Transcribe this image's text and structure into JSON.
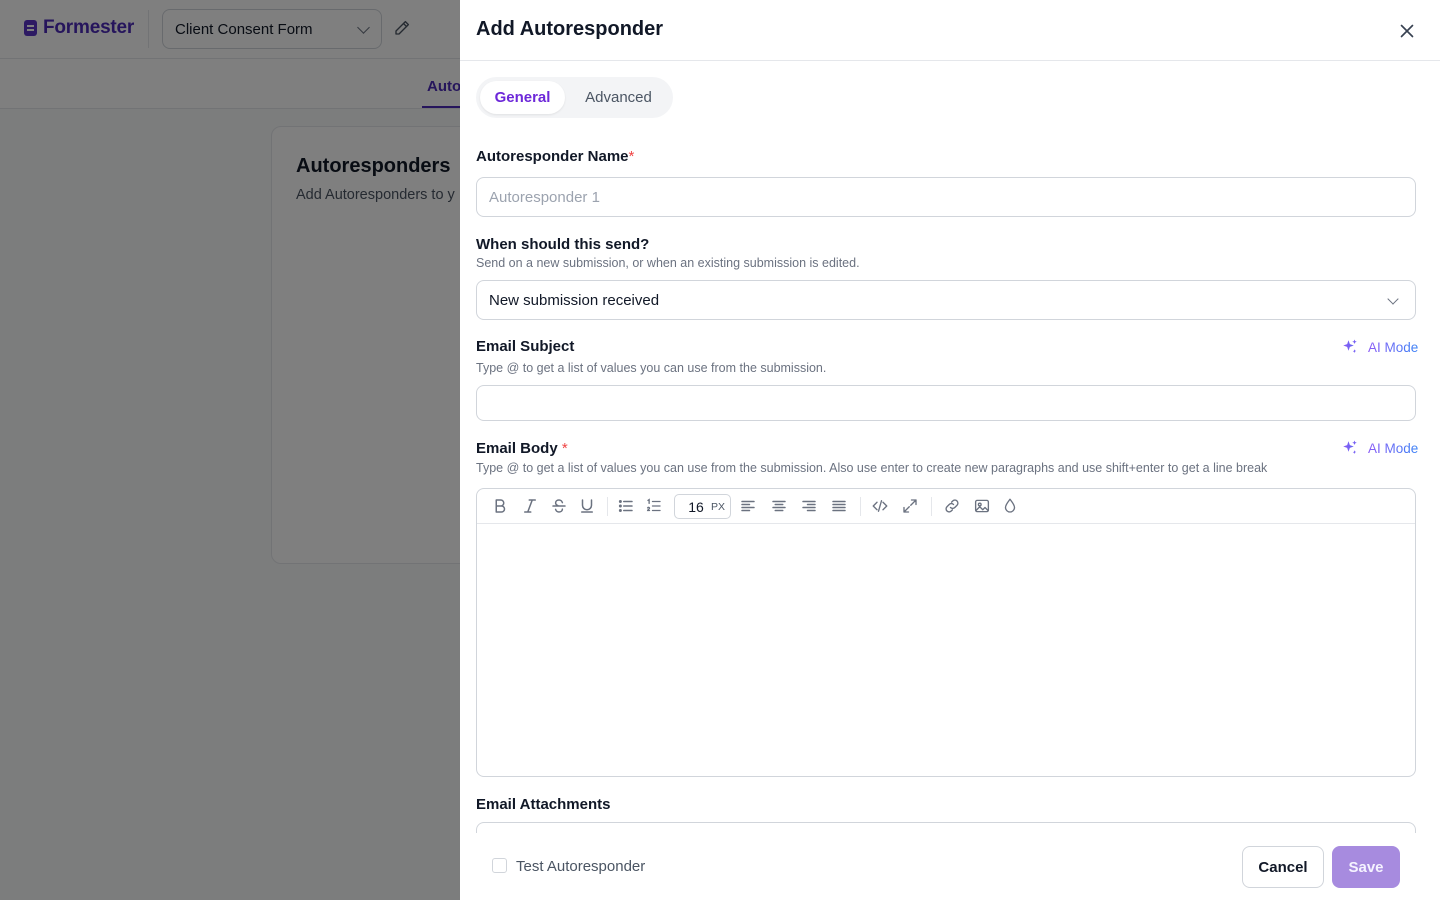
{
  "app": {
    "brand": "Formester",
    "form_selector_value": "Client Consent Form",
    "subnav_tab": "Auto",
    "card_title": "Autoresponders",
    "card_subtitle": "Add Autoresponders to y"
  },
  "drawer": {
    "title": "Add Autoresponder",
    "tabs": [
      {
        "label": "General",
        "active": true
      },
      {
        "label": "Advanced",
        "active": false
      }
    ],
    "name_field": {
      "label": "Autoresponder Name",
      "required_mark": "*",
      "placeholder": "Autoresponder 1",
      "value": ""
    },
    "trigger_field": {
      "label": "When should this send?",
      "hint": "Send on a new submission, or when an existing submission is edited.",
      "selected": "New submission received"
    },
    "subject_field": {
      "label": "Email Subject",
      "hint": "Type @ to get a list of values you can use from the submission.",
      "value": "",
      "ai_mode_label": "AI Mode"
    },
    "body_field": {
      "label": "Email Body",
      "required_mark": "*",
      "hint": "Type @ to get a list of values you can use from the submission. Also use enter to create new paragraphs and use shift+enter to get a line break",
      "ai_mode_label": "AI Mode",
      "font_size": "16",
      "font_unit": "PX",
      "toolbar_icons": [
        "bold-icon",
        "italic-icon",
        "strikethrough-icon",
        "underline-icon",
        "bullet-list-icon",
        "numbered-list-icon",
        "align-left-icon",
        "align-center-icon",
        "align-right-icon",
        "align-justify-icon",
        "code-icon",
        "fullscreen-icon",
        "link-icon",
        "image-icon",
        "color-drop-icon"
      ]
    },
    "attachments_field": {
      "label": "Email Attachments"
    },
    "footer": {
      "test_label": "Test Autoresponder",
      "test_checked": false,
      "cancel_label": "Cancel",
      "save_label": "Save"
    }
  },
  "colors": {
    "brand": "#4c2bb8",
    "active_tab": "#6d28d9",
    "save_button": "#a78bdf",
    "required": "#ef4444",
    "overlay": "rgba(0,0,0,0.5)"
  }
}
